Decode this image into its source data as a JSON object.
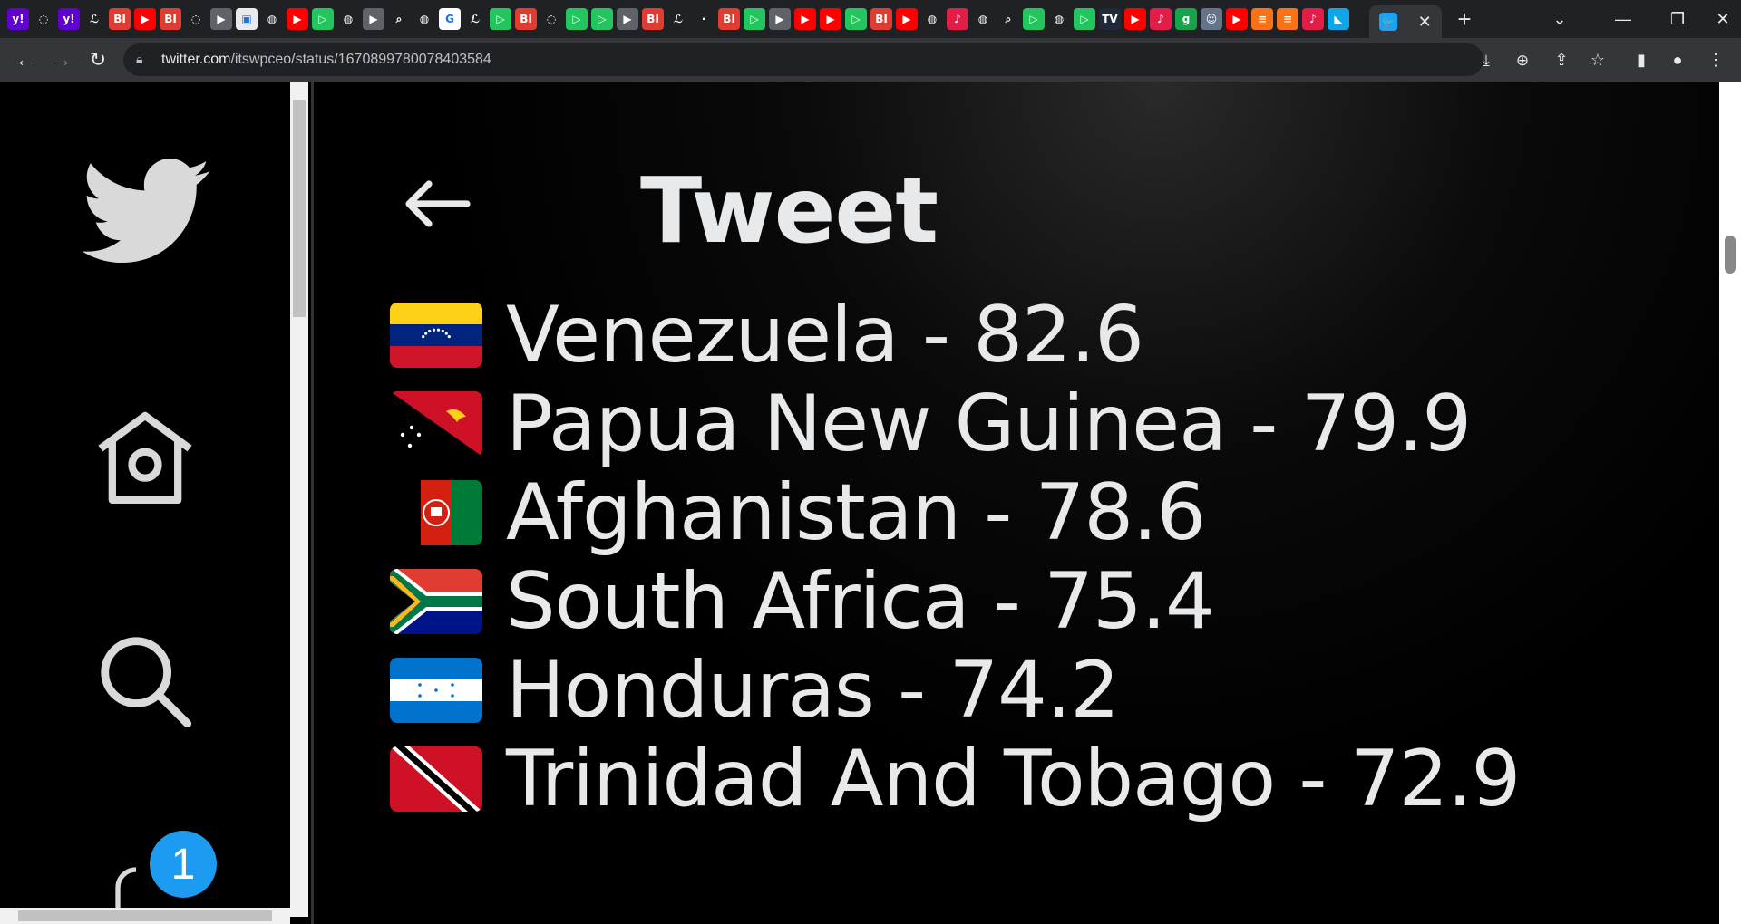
{
  "browser": {
    "tab_favicons": [
      {
        "name": "yahoo-icon",
        "glyph": "y!",
        "color": "#6001d2"
      },
      {
        "name": "shield-icon",
        "glyph": "◌",
        "color": "#202124"
      },
      {
        "name": "yahoo-icon",
        "glyph": "y!",
        "color": "#6001d2"
      },
      {
        "name": "news-icon",
        "glyph": "ℒ",
        "color": "#202124"
      },
      {
        "name": "bi-icon",
        "glyph": "BI",
        "color": "#e03c31"
      },
      {
        "name": "youtube-icon",
        "glyph": "▶",
        "color": "#ff0000"
      },
      {
        "name": "bi-icon",
        "glyph": "BI",
        "color": "#e03c31"
      },
      {
        "name": "shield-icon",
        "glyph": "◌",
        "color": "#202124"
      },
      {
        "name": "forward-icon",
        "glyph": "▶",
        "color": "#5f6368"
      },
      {
        "name": "image-icon",
        "glyph": "▣",
        "color": "#e8eaed"
      },
      {
        "name": "globe-icon",
        "glyph": "◍",
        "color": "#202124"
      },
      {
        "name": "youtube-icon",
        "glyph": "▶",
        "color": "#ff0000"
      },
      {
        "name": "play-icon",
        "glyph": "▷",
        "color": "#22c55e"
      },
      {
        "name": "globe-icon",
        "glyph": "◍",
        "color": "#202124"
      },
      {
        "name": "forward-icon",
        "glyph": "▶",
        "color": "#5f6368"
      },
      {
        "name": "search-icon",
        "glyph": "⌕",
        "color": "#202124"
      },
      {
        "name": "globe-icon",
        "glyph": "◍",
        "color": "#202124"
      },
      {
        "name": "google-icon",
        "glyph": "G",
        "color": "#ffffff"
      },
      {
        "name": "news-icon",
        "glyph": "ℒ",
        "color": "#202124"
      },
      {
        "name": "play-icon",
        "glyph": "▷",
        "color": "#22c55e"
      },
      {
        "name": "bi-icon",
        "glyph": "BI",
        "color": "#e03c31"
      },
      {
        "name": "shield-icon",
        "glyph": "◌",
        "color": "#202124"
      },
      {
        "name": "play-icon",
        "glyph": "▷",
        "color": "#22c55e"
      },
      {
        "name": "play-icon",
        "glyph": "▷",
        "color": "#22c55e"
      },
      {
        "name": "forward-icon",
        "glyph": "▶",
        "color": "#5f6368"
      },
      {
        "name": "bi-icon",
        "glyph": "BI",
        "color": "#e03c31"
      },
      {
        "name": "news-icon",
        "glyph": "ℒ",
        "color": "#202124"
      },
      {
        "name": "blank-icon",
        "glyph": "·",
        "color": "#202124"
      },
      {
        "name": "bi-icon",
        "glyph": "BI",
        "color": "#e03c31"
      },
      {
        "name": "play-icon",
        "glyph": "▷",
        "color": "#22c55e"
      },
      {
        "name": "forward-icon",
        "glyph": "▶",
        "color": "#5f6368"
      },
      {
        "name": "youtube-icon",
        "glyph": "▶",
        "color": "#ff0000"
      },
      {
        "name": "youtube-icon",
        "glyph": "▶",
        "color": "#ff0000"
      },
      {
        "name": "play-icon",
        "glyph": "▷",
        "color": "#22c55e"
      },
      {
        "name": "bi-icon",
        "glyph": "BI",
        "color": "#e03c31"
      },
      {
        "name": "youtube-icon",
        "glyph": "▶",
        "color": "#ff0000"
      },
      {
        "name": "globe-icon",
        "glyph": "◍",
        "color": "#202124"
      },
      {
        "name": "podcast-icon",
        "glyph": "♪",
        "color": "#e11d48"
      },
      {
        "name": "globe-icon",
        "glyph": "◍",
        "color": "#202124"
      },
      {
        "name": "search-icon",
        "glyph": "⌕",
        "color": "#202124"
      },
      {
        "name": "play-icon",
        "glyph": "▷",
        "color": "#22c55e"
      },
      {
        "name": "globe-icon",
        "glyph": "◍",
        "color": "#202124"
      },
      {
        "name": "play-icon",
        "glyph": "▷",
        "color": "#22c55e"
      },
      {
        "name": "tv-icon",
        "glyph": "TV",
        "color": "#1f2937"
      },
      {
        "name": "youtube-icon",
        "glyph": "▶",
        "color": "#ff0000"
      },
      {
        "name": "podcast-icon",
        "glyph": "♪",
        "color": "#e11d48"
      },
      {
        "name": "g-icon",
        "glyph": "g",
        "color": "#16a34a"
      },
      {
        "name": "avatar-icon",
        "glyph": "☺",
        "color": "#64748b"
      },
      {
        "name": "youtube-icon",
        "glyph": "▶",
        "color": "#ff0000"
      },
      {
        "name": "bookmark-icon",
        "glyph": "≡",
        "color": "#f97316"
      },
      {
        "name": "bookmark-icon",
        "glyph": "≡",
        "color": "#f97316"
      },
      {
        "name": "podcast-icon",
        "glyph": "♪",
        "color": "#e11d48"
      },
      {
        "name": "chart-icon",
        "glyph": "◣",
        "color": "#0ea5e9"
      }
    ],
    "url_host": "twitter.com",
    "url_path": "/itswpceo/status/1670899780078403584"
  },
  "sidebar": {
    "notification_count": "1"
  },
  "main": {
    "title": "Tweet",
    "rows": [
      {
        "text": "Venezuela - 82.6",
        "flag": "venezuela"
      },
      {
        "text": "Papua New Guinea - 79.9",
        "flag": "png"
      },
      {
        "text": "Afghanistan - 78.6",
        "flag": "afghanistan"
      },
      {
        "text": "South Africa - 75.4",
        "flag": "south-africa"
      },
      {
        "text": "Honduras - 74.2",
        "flag": "honduras"
      },
      {
        "text": "Trinidad And Tobago - 72.9",
        "flag": "trinidad"
      }
    ]
  }
}
